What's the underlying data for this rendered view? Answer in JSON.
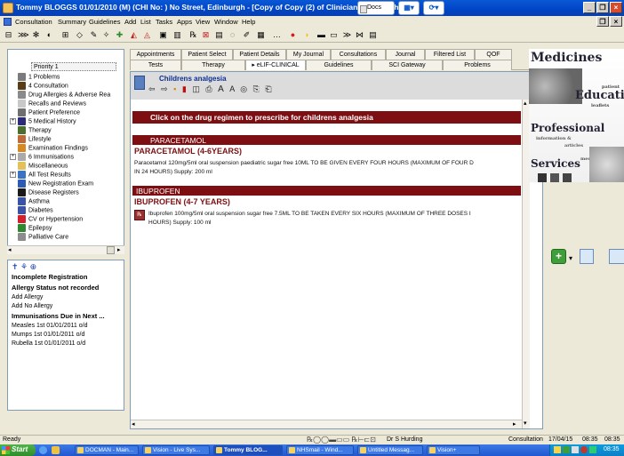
{
  "window": {
    "title": "Tommy BLOGGS 01/01/2010 (M) (CHI No: ) No Street, Edinburgh - [Copy of Copy (2) of Clinician View - with",
    "docs_button": "Docs",
    "min_glyph": "_",
    "restore_glyph": "❐",
    "close_glyph": "×"
  },
  "menu": [
    "Consultation",
    "Summary",
    "Guidelines",
    "Add",
    "List",
    "Tasks",
    "Apps",
    "View",
    "Window",
    "Help"
  ],
  "toolbar": [
    "⊟",
    "⋙",
    "✻",
    "◐",
    "⊞",
    "◇",
    "✎",
    "✧",
    "✚",
    "◭",
    "◬",
    "▣",
    "▥",
    "℞",
    "⊠",
    "▤",
    "◌",
    "✐",
    "▦",
    "…",
    "●",
    "◗",
    "▬",
    "▭",
    "≫",
    "⋈",
    "▤"
  ],
  "tree": {
    "header": "Priority 1",
    "items": [
      {
        "label": "1 Problems",
        "icon_color": "#7b7b7b",
        "expand": ""
      },
      {
        "label": "4 Consultation",
        "icon_color": "#5a3d16",
        "expand": ""
      },
      {
        "label": "Drug Allergies & Adverse Rea",
        "icon_color": "#8a8a8a",
        "expand": ""
      },
      {
        "label": "Recalls and Reviews",
        "icon_color": "#c8c8c8",
        "expand": ""
      },
      {
        "label": "Patient Preference",
        "icon_color": "#6f6f6f",
        "expand": ""
      },
      {
        "label": "5 Medical History",
        "icon_color": "#2b2b7a",
        "expand": "+"
      },
      {
        "label": "Therapy",
        "icon_color": "#4b6f2d",
        "expand": ""
      },
      {
        "label": "Lifestyle",
        "icon_color": "#c06a3a",
        "expand": ""
      },
      {
        "label": "Examination Findings",
        "icon_color": "#d68a23",
        "expand": ""
      },
      {
        "label": "6 Immunisations",
        "icon_color": "#aaaaaa",
        "expand": "+"
      },
      {
        "label": "Miscellaneous",
        "icon_color": "#e2c15a",
        "expand": ""
      },
      {
        "label": "All Test Results",
        "icon_color": "#3b73c4",
        "expand": "+"
      },
      {
        "label": "New Registration Exam",
        "icon_color": "#2c5ab5",
        "expand": ""
      },
      {
        "label": "Disease Registers",
        "icon_color": "#1a1a1a",
        "expand": ""
      },
      {
        "label": "Asthma",
        "icon_color": "#3a53a8",
        "expand": ""
      },
      {
        "label": "Diabetes",
        "icon_color": "#3a53a8",
        "expand": ""
      },
      {
        "label": "CV or Hypertension",
        "icon_color": "#d4202c",
        "expand": ""
      },
      {
        "label": "Epilepsy",
        "icon_color": "#2f8a2f",
        "expand": ""
      },
      {
        "label": "Palliative Care",
        "icon_color": "#8d8d8d",
        "expand": ""
      }
    ]
  },
  "alerts": {
    "incomplete_registration": "Incomplete Registration",
    "allergy_status": "Allergy Status not recorded",
    "add_allergy": "Add Allergy",
    "add_no_allergy": "Add No Allergy",
    "immunisations_due": "Immunisations Due in Next ...",
    "due_items": [
      "Measles 1st 01/01/2011  o/d",
      "Mumps 1st 01/01/2011  o/d",
      "Rubella 1st 01/01/2011  o/d"
    ]
  },
  "tabs_row1": [
    "Appointments",
    "Patient Select",
    "Patient Details",
    "My Journal",
    "Consultations",
    "Journal",
    "Filtered List",
    "QOF"
  ],
  "tabs_row2": [
    "Tests",
    "Therapy",
    "▸ eLIF-CLINICAL",
    "Guidelines",
    "SCI Gateway",
    "Problems"
  ],
  "active_tab": "▸ eLIF-CLINICAL",
  "document": {
    "title": "Childrens analgesia",
    "doc_toolbar": [
      "⇦",
      "⇨",
      "▪",
      "▮",
      "◫",
      "⎙",
      "A",
      "A",
      "◎",
      "⎘",
      "⎗"
    ],
    "instruction": "Click on the drug regimen to prescribe for childrens analgesia",
    "sections": [
      {
        "heading": "PARACETAMOL",
        "subheading": "PARACETAMOL (4-6YEARS)",
        "text_line1": "Paracetamol 120mg/5ml oral suspension paediatric sugar free 10ML TO BE GIVEN EVERY FOUR HOURS (MAXIMUM OF FOUR D",
        "text_line2": "IN 24 HOURS)  Supply:  200 ml",
        "has_rx_icon": false
      },
      {
        "heading": "IBUPROFEN",
        "subheading": "IBUPROFEN (4-7 YEARS)",
        "text_line1": "Ibuprofen 100mg/5ml oral suspension sugar free 7.5ML TO BE TAKEN EVERY SIX HOURS (MAXIMUM OF THREE DOSES I",
        "text_line2": "HOURS)  Supply:  100 ml",
        "has_rx_icon": true
      }
    ]
  },
  "side_panel": {
    "words": [
      "Medicines",
      "patient",
      "Education",
      "leaflets",
      "Professional",
      "information &",
      "articles",
      "Services",
      "medical"
    ]
  },
  "status": {
    "left": "Ready",
    "user": "Dr S Hurding",
    "mode": "Consultation",
    "date": "17/04/15",
    "time1": "08:35",
    "time2": "08:35"
  },
  "taskbar": {
    "start": "Start",
    "buttons": [
      "DOCMAN - Main...",
      "Vision - Live Sys...",
      "Tommy BLOG...",
      "NHSmail - Wind...",
      "Untitled Messag...",
      "Vision+"
    ],
    "clock": "08:35"
  },
  "colors": {
    "accent_red": "#7d0f12",
    "title_blue": "#0b2f94",
    "xp_blue": "#0a58d6"
  }
}
